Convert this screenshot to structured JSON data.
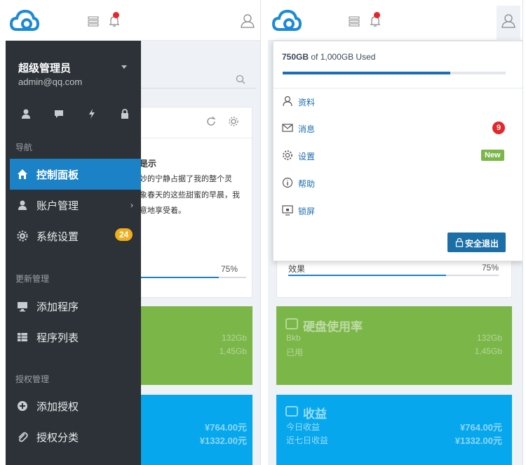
{
  "left": {
    "sidebar": {
      "user_name": "超级管理员",
      "user_email": "admin@qq.com",
      "quick_icons": [
        "user-icon",
        "chat-icon",
        "lightning-icon",
        "lock-icon"
      ],
      "section_nav": "导航",
      "section_update": "更新管理",
      "section_auth": "授权管理",
      "items": [
        {
          "label": "控制面板",
          "icon": "home-icon"
        },
        {
          "label": "账户管理",
          "icon": "account-icon",
          "arrow": "›"
        },
        {
          "label": "系统设置",
          "icon": "gear-icon",
          "badge": "24"
        },
        {
          "label": "添加程序",
          "icon": "monitor-icon"
        },
        {
          "label": "程序列表",
          "icon": "table-icon"
        },
        {
          "label": "添加授权",
          "icon": "plus-circle-icon"
        },
        {
          "label": "授权分类",
          "icon": "paperclip-icon"
        }
      ]
    },
    "content": {
      "card_title_fragment": "是示",
      "card_lines": [
        "妙的宁静占据了我的整个灵",
        "象春天的这些甜蜜的早晨，我",
        "意地享受着。"
      ],
      "progress_pct": "75%",
      "progress_value": 0.75,
      "green_values": [
        "132Gb",
        "1,45Gb"
      ],
      "blue_values": [
        "¥764.00元",
        "¥1332.00元"
      ]
    }
  },
  "right": {
    "storage_used": "750GB",
    "storage_rest": " of 1,000GB Used",
    "storage_fraction": 0.75,
    "menu": [
      {
        "label": "资料",
        "icon": "user-icon"
      },
      {
        "label": "消息",
        "icon": "mail-icon",
        "badge": "9"
      },
      {
        "label": "设置",
        "icon": "gear-icon",
        "badge": "New"
      },
      {
        "label": "帮助",
        "icon": "info-icon"
      },
      {
        "label": "锁屏",
        "icon": "monitor-lock-icon"
      }
    ],
    "logout_label": "安全退出",
    "effect_label": "效果",
    "effect_pct": "75%",
    "disk_title": "硬盘使用率",
    "disk_rows": [
      {
        "label": "Bkb",
        "value": "132Gb"
      },
      {
        "label": "已用",
        "value": "1,45Gb"
      }
    ],
    "income_title": "收益",
    "income_rows": [
      {
        "label": "今日收益",
        "value": "¥764.00元"
      },
      {
        "label": "近七日收益",
        "value": "¥1332.00元"
      }
    ]
  },
  "colors": {
    "sidebar": "#2c3237",
    "active": "#1b82c8",
    "green": "#7ab648",
    "blue": "#06a7ec",
    "badge_red": "#e5262b",
    "badge_green": "#7ab648",
    "badge_orange": "#f0ad1e"
  }
}
